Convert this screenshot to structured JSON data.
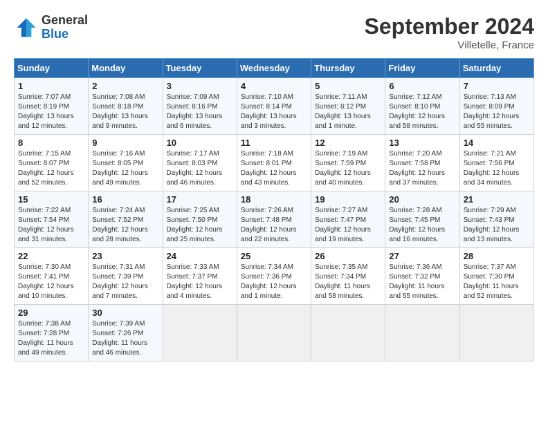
{
  "header": {
    "logo_text_general": "General",
    "logo_text_blue": "Blue",
    "month_title": "September 2024",
    "location": "Villetelle, France"
  },
  "days_of_week": [
    "Sunday",
    "Monday",
    "Tuesday",
    "Wednesday",
    "Thursday",
    "Friday",
    "Saturday"
  ],
  "weeks": [
    [
      {
        "day": "1",
        "sunrise": "7:07 AM",
        "sunset": "8:19 PM",
        "daylight": "13 hours and 12 minutes."
      },
      {
        "day": "2",
        "sunrise": "7:08 AM",
        "sunset": "8:18 PM",
        "daylight": "13 hours and 9 minutes."
      },
      {
        "day": "3",
        "sunrise": "7:09 AM",
        "sunset": "8:16 PM",
        "daylight": "13 hours and 6 minutes."
      },
      {
        "day": "4",
        "sunrise": "7:10 AM",
        "sunset": "8:14 PM",
        "daylight": "13 hours and 3 minutes."
      },
      {
        "day": "5",
        "sunrise": "7:11 AM",
        "sunset": "8:12 PM",
        "daylight": "13 hours and 1 minute."
      },
      {
        "day": "6",
        "sunrise": "7:12 AM",
        "sunset": "8:10 PM",
        "daylight": "12 hours and 58 minutes."
      },
      {
        "day": "7",
        "sunrise": "7:13 AM",
        "sunset": "8:09 PM",
        "daylight": "12 hours and 55 minutes."
      }
    ],
    [
      {
        "day": "8",
        "sunrise": "7:15 AM",
        "sunset": "8:07 PM",
        "daylight": "12 hours and 52 minutes."
      },
      {
        "day": "9",
        "sunrise": "7:16 AM",
        "sunset": "8:05 PM",
        "daylight": "12 hours and 49 minutes."
      },
      {
        "day": "10",
        "sunrise": "7:17 AM",
        "sunset": "8:03 PM",
        "daylight": "12 hours and 46 minutes."
      },
      {
        "day": "11",
        "sunrise": "7:18 AM",
        "sunset": "8:01 PM",
        "daylight": "12 hours and 43 minutes."
      },
      {
        "day": "12",
        "sunrise": "7:19 AM",
        "sunset": "7:59 PM",
        "daylight": "12 hours and 40 minutes."
      },
      {
        "day": "13",
        "sunrise": "7:20 AM",
        "sunset": "7:58 PM",
        "daylight": "12 hours and 37 minutes."
      },
      {
        "day": "14",
        "sunrise": "7:21 AM",
        "sunset": "7:56 PM",
        "daylight": "12 hours and 34 minutes."
      }
    ],
    [
      {
        "day": "15",
        "sunrise": "7:22 AM",
        "sunset": "7:54 PM",
        "daylight": "12 hours and 31 minutes."
      },
      {
        "day": "16",
        "sunrise": "7:24 AM",
        "sunset": "7:52 PM",
        "daylight": "12 hours and 28 minutes."
      },
      {
        "day": "17",
        "sunrise": "7:25 AM",
        "sunset": "7:50 PM",
        "daylight": "12 hours and 25 minutes."
      },
      {
        "day": "18",
        "sunrise": "7:26 AM",
        "sunset": "7:48 PM",
        "daylight": "12 hours and 22 minutes."
      },
      {
        "day": "19",
        "sunrise": "7:27 AM",
        "sunset": "7:47 PM",
        "daylight": "12 hours and 19 minutes."
      },
      {
        "day": "20",
        "sunrise": "7:28 AM",
        "sunset": "7:45 PM",
        "daylight": "12 hours and 16 minutes."
      },
      {
        "day": "21",
        "sunrise": "7:29 AM",
        "sunset": "7:43 PM",
        "daylight": "12 hours and 13 minutes."
      }
    ],
    [
      {
        "day": "22",
        "sunrise": "7:30 AM",
        "sunset": "7:41 PM",
        "daylight": "12 hours and 10 minutes."
      },
      {
        "day": "23",
        "sunrise": "7:31 AM",
        "sunset": "7:39 PM",
        "daylight": "12 hours and 7 minutes."
      },
      {
        "day": "24",
        "sunrise": "7:33 AM",
        "sunset": "7:37 PM",
        "daylight": "12 hours and 4 minutes."
      },
      {
        "day": "25",
        "sunrise": "7:34 AM",
        "sunset": "7:36 PM",
        "daylight": "12 hours and 1 minute."
      },
      {
        "day": "26",
        "sunrise": "7:35 AM",
        "sunset": "7:34 PM",
        "daylight": "11 hours and 58 minutes."
      },
      {
        "day": "27",
        "sunrise": "7:36 AM",
        "sunset": "7:32 PM",
        "daylight": "11 hours and 55 minutes."
      },
      {
        "day": "28",
        "sunrise": "7:37 AM",
        "sunset": "7:30 PM",
        "daylight": "11 hours and 52 minutes."
      }
    ],
    [
      {
        "day": "29",
        "sunrise": "7:38 AM",
        "sunset": "7:28 PM",
        "daylight": "11 hours and 49 minutes."
      },
      {
        "day": "30",
        "sunrise": "7:39 AM",
        "sunset": "7:26 PM",
        "daylight": "11 hours and 46 minutes."
      },
      null,
      null,
      null,
      null,
      null
    ]
  ]
}
